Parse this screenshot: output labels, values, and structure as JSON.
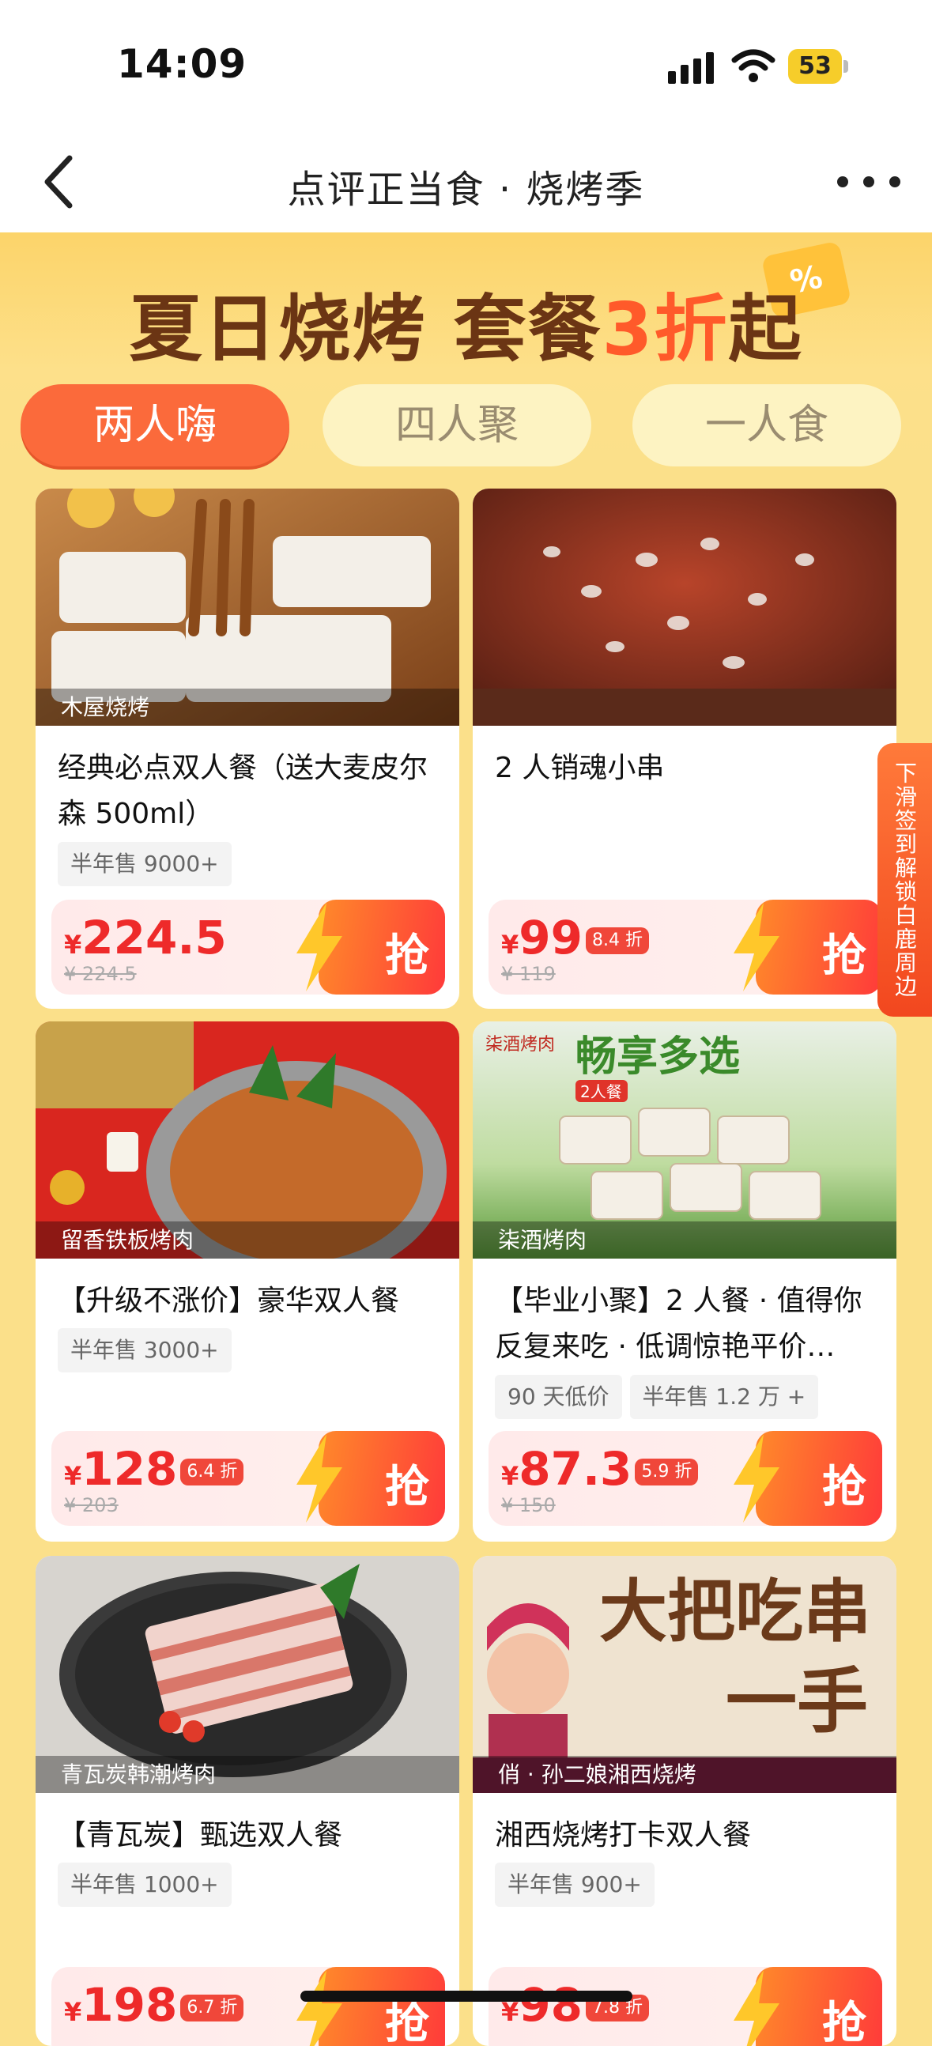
{
  "status_bar": {
    "time": "14:09",
    "battery": "53"
  },
  "nav": {
    "title": "点评正当食 · 烧烤季"
  },
  "banner": {
    "title_main": "夏日烧烤 套餐",
    "title_highlight": "3折",
    "title_end": "起",
    "coupon_symbol": "%"
  },
  "tabs": [
    {
      "label": "两人嗨",
      "active": true
    },
    {
      "label": "四人聚",
      "active": false
    },
    {
      "label": "一人食",
      "active": false
    }
  ],
  "side_tab": {
    "label": "下滑签到解锁白鹿周边"
  },
  "grab_label": "抢",
  "currency": "¥",
  "cards": [
    {
      "shop": "木屋烧烤",
      "title": "经典必点双人餐（送大麦皮尔森 500ml）",
      "tags": [
        "半年售 9000+"
      ],
      "price": "224.5",
      "discount": "",
      "original": "¥ 224.5"
    },
    {
      "shop": "",
      "title": "2 人销魂小串",
      "tags": [],
      "price": "99",
      "discount": "8.4 折",
      "original": "¥ 119"
    },
    {
      "shop": "留香铁板烤肉",
      "title": "【升级不涨价】豪华双人餐",
      "tags": [
        "半年售 3000+"
      ],
      "price": "128",
      "discount": "6.4 折",
      "original": "¥ 203"
    },
    {
      "shop": "柒酒烤肉",
      "title": "【毕业小聚】2 人餐 · 值得你反复来吃 · 低调惊艳平价…",
      "tags": [
        "90 天低价",
        "半年售 1.2 万 +"
      ],
      "price": "87.3",
      "discount": "5.9 折",
      "original": "¥ 150"
    },
    {
      "shop": "青瓦炭韩潮烤肉",
      "title": "【青瓦炭】甄选双人餐",
      "tags": [
        "半年售 1000+"
      ],
      "price": "198",
      "discount": "6.7 折",
      "original": ""
    },
    {
      "shop": "俏 · 孙二娘湘西烧烤",
      "title": "湘西烧烤打卡双人餐",
      "tags": [
        "半年售 900+"
      ],
      "price": "98",
      "discount": "7.8 折",
      "original": ""
    }
  ],
  "image_texts": {
    "card4_brand": "柒酒烤肉",
    "card4_headline": "畅享多选",
    "card4_badge": "2人餐",
    "card6_headline": "大把吃串",
    "card6_headline2": "一手"
  }
}
